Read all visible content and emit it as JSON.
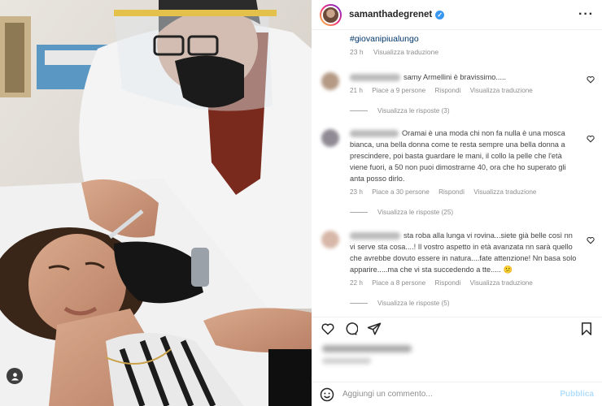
{
  "header": {
    "username": "samanthadegrenet",
    "verified_mark": "✓",
    "more_icon": "more-horizontal-icon"
  },
  "caption": {
    "hashtag": "#giovanipiualungo",
    "time": "23 h",
    "translate": "Visualizza traduzione"
  },
  "comments": [
    {
      "text": "samy Armellini è bravissimo.....",
      "time": "21 h",
      "likes": "Piace a 9 persone",
      "reply": "Rispondi",
      "translate": "Visualizza traduzione",
      "view_replies": "Visualizza le risposte (3)"
    },
    {
      "text": "Oramai è una moda chi non fa nulla è una mosca bianca, una bella donna come te resta sempre una bella donna a prescindere, poi basta guardare le mani, il collo la pelle che l'età viene fuori, a 50 non puoi dimostrarne 40, ora che ho superato gli anta posso dirlo.",
      "time": "23 h",
      "likes": "Piace a 30 persone",
      "reply": "Rispondi",
      "translate": "Visualizza traduzione",
      "view_replies": "Visualizza le risposte (25)"
    },
    {
      "text": "sta roba alla lunga vi rovina...siete già belle così nn vi serve sta cosa....! Il vostro aspetto in età avanzata nn sarà quello che avrebbe dovuto essere in natura....fate attenzione! Nn basa solo apparire.....ma che vi sta succedendo a tte..... 😕",
      "time": "22 h",
      "likes": "Piace a 8 persone",
      "reply": "Rispondi",
      "translate": "Visualizza traduzione",
      "view_replies": "Visualizza le risposte (5)"
    }
  ],
  "actions": {
    "like_icon": "heart-icon",
    "comment_icon": "comment-icon",
    "share_icon": "send-icon",
    "save_icon": "bookmark-icon"
  },
  "add_comment": {
    "emoji_icon": "emoji-icon",
    "placeholder": "Aggiungi un commento...",
    "publish": "Pubblica"
  },
  "colors": {
    "link": "#00376b",
    "meta": "#8e8e8e",
    "publish_disabled": "#b2dffc",
    "verified": "#3897f0"
  }
}
